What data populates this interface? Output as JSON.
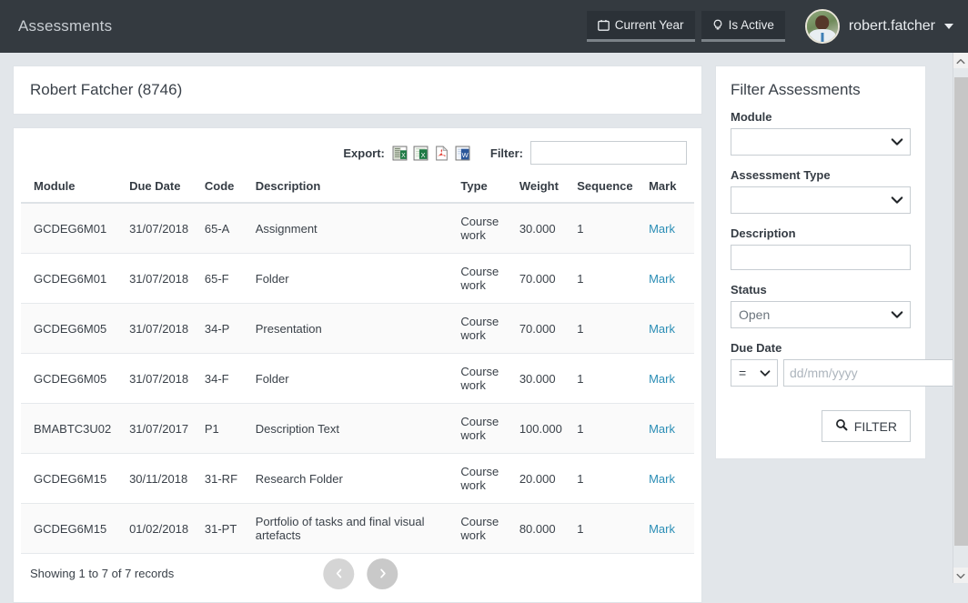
{
  "topbar": {
    "title": "Assessments",
    "current_year_label": "Current Year",
    "is_active_label": "Is Active",
    "username": "robert.fatcher"
  },
  "student": {
    "title": "Robert Fatcher (8746)"
  },
  "tools": {
    "export_label": "Export:",
    "filter_label": "Filter:",
    "filter_value": "",
    "filter_placeholder": ""
  },
  "table": {
    "headers": [
      "Module",
      "Due Date",
      "Code",
      "Description",
      "Type",
      "Weight",
      "Sequence",
      "Mark"
    ],
    "rows": [
      {
        "module": "GCDEG6M01",
        "due": "31/07/2018",
        "code": "65-A",
        "desc": "Assignment",
        "type": "Course work",
        "weight": "30.000",
        "seq": "1",
        "mark": "Mark"
      },
      {
        "module": "GCDEG6M01",
        "due": "31/07/2018",
        "code": "65-F",
        "desc": "Folder",
        "type": "Course work",
        "weight": "70.000",
        "seq": "1",
        "mark": "Mark"
      },
      {
        "module": "GCDEG6M05",
        "due": "31/07/2018",
        "code": "34-P",
        "desc": "Presentation",
        "type": "Course work",
        "weight": "70.000",
        "seq": "1",
        "mark": "Mark"
      },
      {
        "module": "GCDEG6M05",
        "due": "31/07/2018",
        "code": "34-F",
        "desc": "Folder",
        "type": "Course work",
        "weight": "30.000",
        "seq": "1",
        "mark": "Mark"
      },
      {
        "module": "BMABTC3U02",
        "due": "31/07/2017",
        "code": "P1",
        "desc": "Description Text",
        "type": "Course work",
        "weight": "100.000",
        "seq": "1",
        "mark": "Mark"
      },
      {
        "module": "GCDEG6M15",
        "due": "30/11/2018",
        "code": "31-RF",
        "desc": "Research Folder",
        "type": "Course work",
        "weight": "20.000",
        "seq": "1",
        "mark": "Mark"
      },
      {
        "module": "GCDEG6M15",
        "due": "01/02/2018",
        "code": "31-PT",
        "desc": "Portfolio of tasks and final visual artefacts",
        "type": "Course work",
        "weight": "80.000",
        "seq": "1",
        "mark": "Mark"
      }
    ],
    "records_text": "Showing 1 to 7 of 7 records"
  },
  "sidebar": {
    "heading": "Filter Assessments",
    "module_label": "Module",
    "module_value": "",
    "assessment_type_label": "Assessment Type",
    "assessment_type_value": "",
    "description_label": "Description",
    "description_value": "",
    "status_label": "Status",
    "status_value": "Open",
    "due_date_label": "Due Date",
    "due_operator": "=",
    "due_date_value": "",
    "due_date_placeholder": "dd/mm/yyyy",
    "filter_button_label": "FILTER"
  },
  "colors": {
    "topbar_bg": "#343a40",
    "page_bg": "#e2e6ea",
    "link": "#2a8db5",
    "card_bg": "#ffffff"
  }
}
